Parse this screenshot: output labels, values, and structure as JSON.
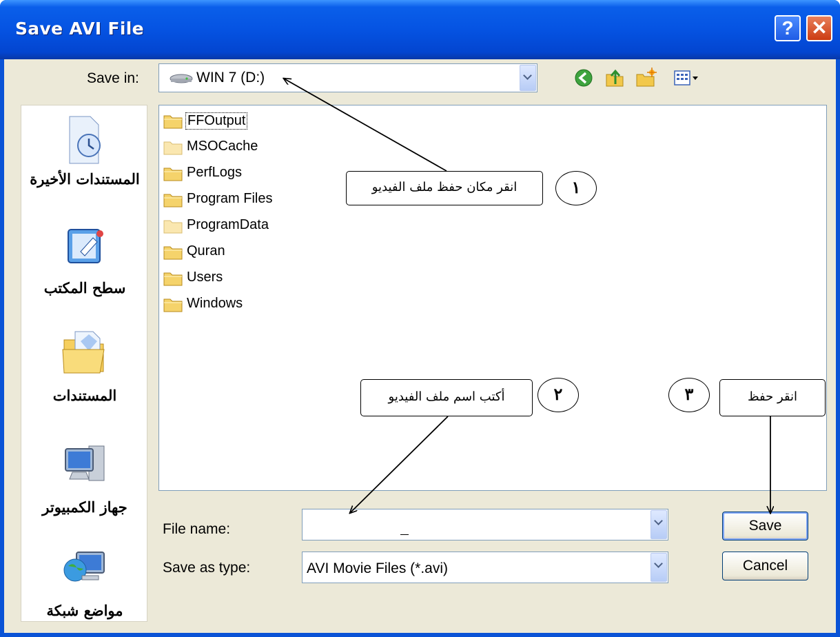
{
  "window": {
    "title": "Save AVI File",
    "help_label": "?",
    "close_label": "✕"
  },
  "save_in": {
    "label": "Save in:",
    "value": "WIN 7 (D:)",
    "drive_icon": "drive-icon"
  },
  "toolbar": {
    "icons": [
      "back-icon",
      "up-folder-icon",
      "new-folder-icon",
      "view-menu-icon"
    ]
  },
  "places": [
    {
      "label": "المستندات الأخيرة",
      "icon": "recent-documents-icon"
    },
    {
      "label": "سطح المكتب",
      "icon": "desktop-icon"
    },
    {
      "label": "المستندات",
      "icon": "my-documents-icon"
    },
    {
      "label": "جهاز الكمبيوتر",
      "icon": "my-computer-icon"
    },
    {
      "label": "مواضع شبكة",
      "icon": "network-places-icon"
    }
  ],
  "files": [
    {
      "name": "FFOutput",
      "selected": true,
      "faded": false
    },
    {
      "name": "MSOCache",
      "selected": false,
      "faded": true
    },
    {
      "name": "PerfLogs",
      "selected": false,
      "faded": false
    },
    {
      "name": "Program Files",
      "selected": false,
      "faded": false
    },
    {
      "name": "ProgramData",
      "selected": false,
      "faded": true
    },
    {
      "name": "Quran",
      "selected": false,
      "faded": false
    },
    {
      "name": "Users",
      "selected": false,
      "faded": false
    },
    {
      "name": "Windows",
      "selected": false,
      "faded": false
    }
  ],
  "file_name": {
    "label": "File name:",
    "value": ""
  },
  "save_as_type": {
    "label": "Save as type:",
    "value": "AVI Movie Files (*.avi)"
  },
  "buttons": {
    "save": "Save",
    "cancel": "Cancel"
  },
  "annotations": {
    "step1": {
      "number": "١",
      "text": "انقر مكان حفظ ملف الفيديو"
    },
    "step2": {
      "number": "٢",
      "text": "أكتب اسم ملف الفيديو"
    },
    "step3": {
      "number": "٣",
      "text": "انقر حفظ"
    }
  },
  "colors": {
    "titlebar": "#0553e2",
    "dialog_bg": "#ece9d8",
    "folder": "#f5d36b"
  }
}
